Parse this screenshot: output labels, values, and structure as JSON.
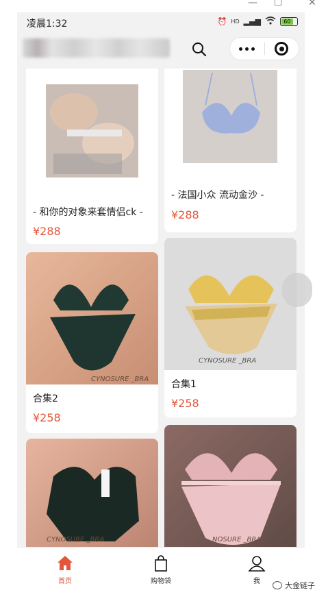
{
  "window": {
    "minimize": "—",
    "maximize": "☐",
    "close": "✕"
  },
  "status_bar": {
    "time": "凌晨1:32",
    "alarm": "⏰",
    "hd": "HD",
    "signal": "▂▄▆",
    "wifi": "wifi",
    "battery": "60"
  },
  "nav": {
    "search_icon": "search-icon",
    "more_icon": "more-icon",
    "close_icon": "close-target-icon"
  },
  "products": [
    {
      "title": "- 和你的对象来套情侣ck -",
      "price": "¥288"
    },
    {
      "title": "- 法国小众 流动金沙 -",
      "price": "¥288"
    },
    {
      "title": "合集2",
      "price": "¥258"
    },
    {
      "title": "合集1",
      "price": "¥258"
    },
    {
      "title": "",
      "price": ""
    },
    {
      "title": "",
      "price": ""
    }
  ],
  "image_watermarks": [
    "CYNOSURE _BRA",
    "CYNOSURE _BRA",
    "CYNOSURE _BRA",
    "NOSURE _BRA"
  ],
  "tabbar": {
    "items": [
      {
        "label": "首页",
        "icon": "home-icon",
        "active": true
      },
      {
        "label": "购物袋",
        "icon": "shopping-bag-icon",
        "active": false
      },
      {
        "label": "我",
        "icon": "user-icon",
        "active": false
      }
    ]
  },
  "watermark": {
    "text": "大金链子"
  },
  "colors": {
    "accent": "#e2563a",
    "background": "#f2f2f2",
    "card": "#ffffff"
  }
}
